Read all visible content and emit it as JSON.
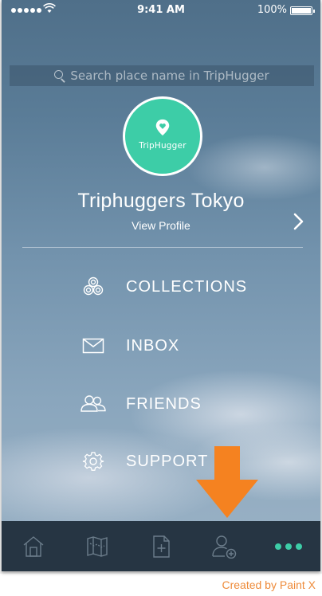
{
  "status_bar": {
    "time": "9:41 AM",
    "battery_pct": "100%",
    "signal_dots": 5,
    "wifi_icon": "wifi-icon"
  },
  "search": {
    "placeholder": "Search place name in TripHugger",
    "icon": "search-icon"
  },
  "profile": {
    "avatar_label": "TripHugger",
    "avatar_icon": "map-pin-heart-icon",
    "name": "Triphuggers Tokyo",
    "view_profile": "View Profile",
    "chevron_icon": "chevron-right-icon"
  },
  "menu": {
    "items": [
      {
        "label": "COLLECTIONS",
        "icon": "collections-icon"
      },
      {
        "label": "INBOX",
        "icon": "envelope-icon"
      },
      {
        "label": "FRIENDS",
        "icon": "friends-icon"
      },
      {
        "label": "SUPPORT",
        "icon": "gear-icon"
      }
    ]
  },
  "tabbar": {
    "tabs": [
      {
        "name": "home",
        "icon": "home-icon"
      },
      {
        "name": "map",
        "icon": "map-icon"
      },
      {
        "name": "new",
        "icon": "add-document-icon"
      },
      {
        "name": "add-friend",
        "icon": "add-user-icon"
      },
      {
        "name": "more",
        "icon": "more-dots-icon",
        "active": true
      }
    ]
  },
  "annotation": {
    "arrow_icon": "down-arrow-icon",
    "credit": "Created by Paint X"
  },
  "colors": {
    "accent": "#3dcda7",
    "tabbar": "#1c2a37",
    "arrow": "#f58220",
    "credit": "#ee8b3a"
  }
}
